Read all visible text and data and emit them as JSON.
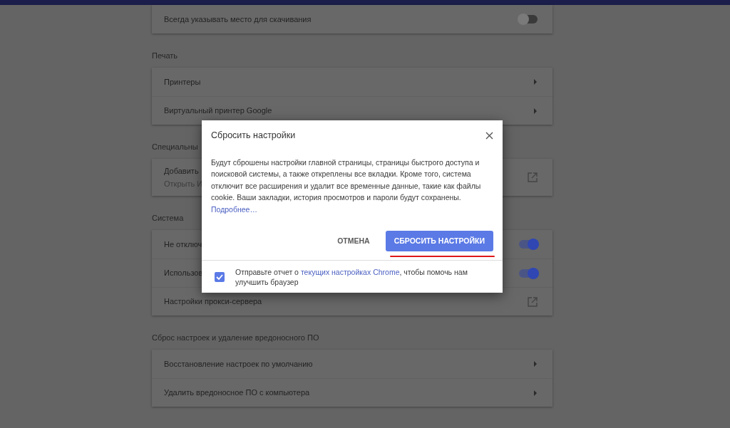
{
  "sections": [
    {
      "rows": [
        {
          "kind": "toggle",
          "label": "Всегда указывать место для скачивания",
          "on": false
        }
      ]
    },
    {
      "heading": "Печать",
      "rows": [
        {
          "kind": "arrow",
          "label": "Принтеры"
        },
        {
          "kind": "arrow",
          "label": "Виртуальный принтер Google"
        }
      ]
    },
    {
      "heading": "Специальны",
      "rows": [
        {
          "kind": "external",
          "label": "Добавить",
          "sublabel": "Открыть И"
        }
      ]
    },
    {
      "heading": "Система",
      "rows": [
        {
          "kind": "toggle",
          "label": "Не отключ",
          "on": true
        },
        {
          "kind": "toggle",
          "label": "Использов",
          "on": true
        },
        {
          "kind": "external",
          "label": "Настройки прокси-сервера"
        }
      ]
    },
    {
      "heading": "Сброс настроек и удаление вредоносного ПО",
      "rows": [
        {
          "kind": "arrow",
          "label": "Восстановление настроек по умолчанию"
        },
        {
          "kind": "arrow",
          "label": "Удалить вредоносное ПО с компьютера"
        }
      ]
    }
  ],
  "dialog": {
    "title": "Сбросить настройки",
    "body": "Будут сброшены настройки главной страницы, страницы быстрого доступа и поисковой системы, а также откреплены все вкладки. Кроме того, система отключит все расширения и удалит все временные данные, такие как файлы cookie. Ваши закладки, история просмотров и пароли будут сохранены.",
    "link": "Подробнее…",
    "cancel": "ОТМЕНА",
    "confirm": "СБРОСИТЬ НАСТРОЙКИ",
    "report": {
      "checked": true,
      "before": "Отправьте отчет о ",
      "link": "текущих настройках Chrome",
      "after": ", чтобы помочь нам улучшить браузер"
    }
  }
}
